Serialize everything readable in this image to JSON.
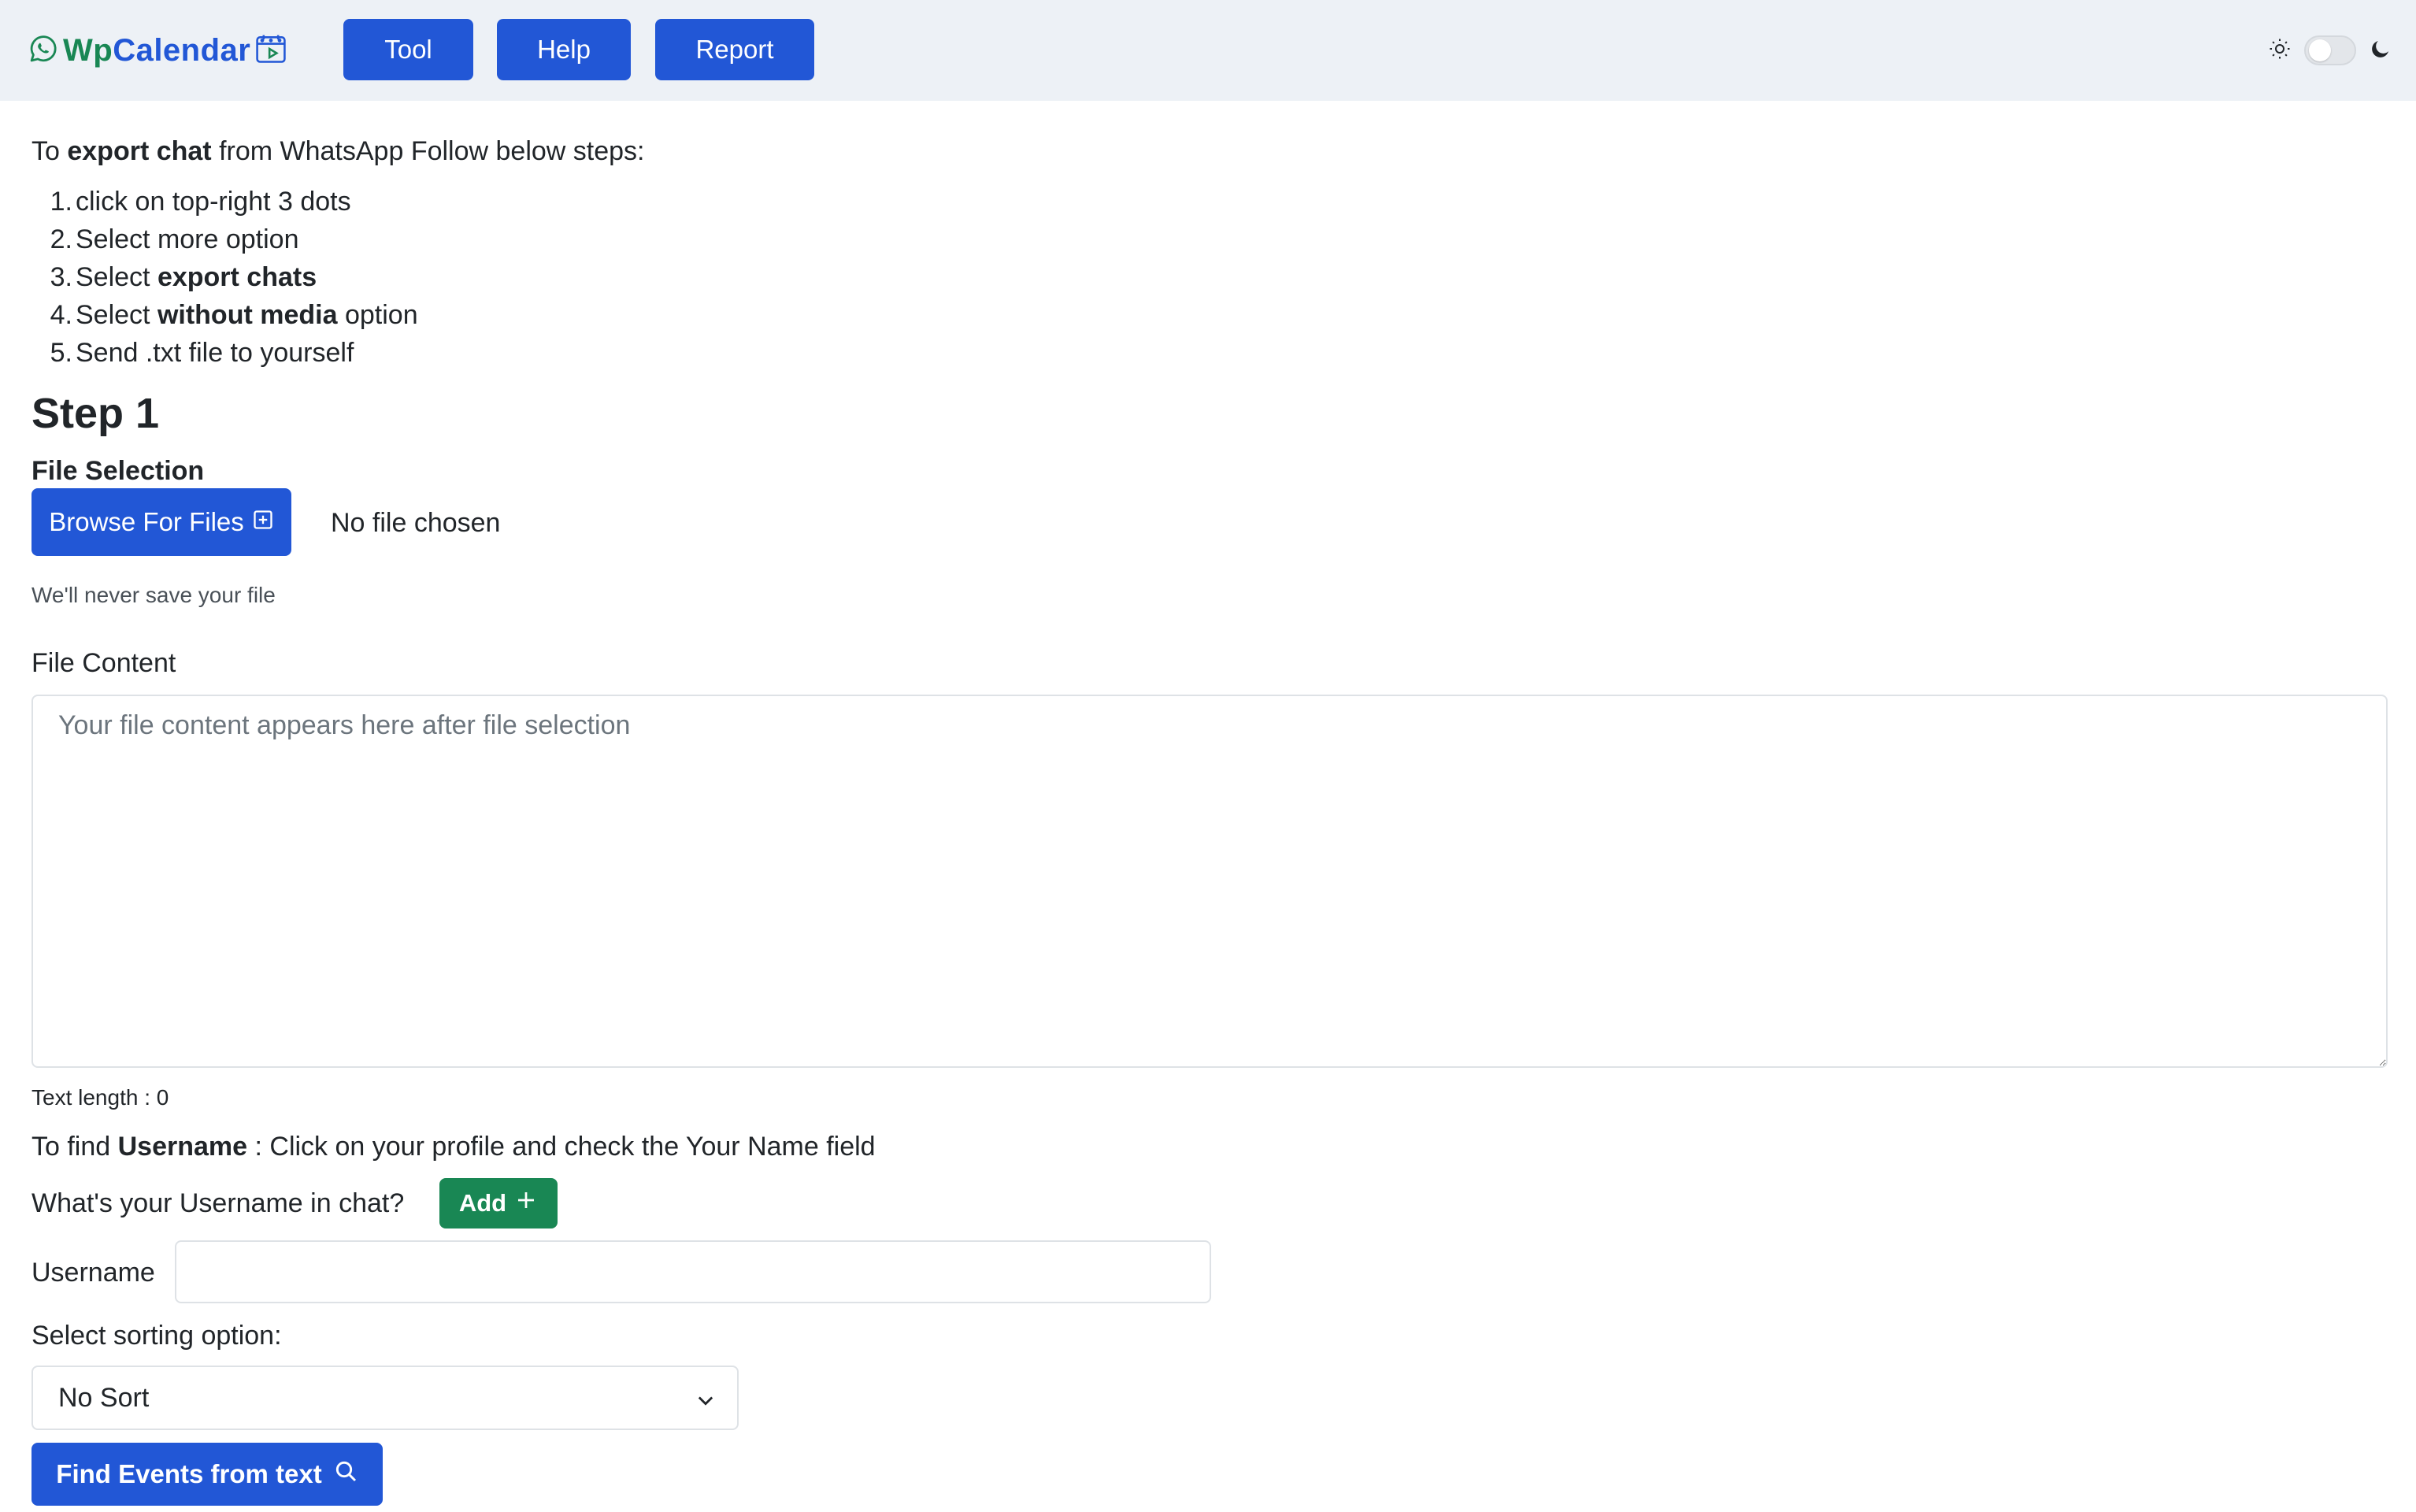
{
  "header": {
    "brand_part1": "Wp",
    "brand_part2": "Calendar",
    "nav": {
      "tool": "Tool",
      "help": "Help",
      "report": "Report"
    },
    "theme_toggle_on": false
  },
  "intro": {
    "prefix": "To ",
    "bold": "export chat",
    "suffix": " from WhatsApp Follow below steps:"
  },
  "steps": [
    {
      "num": "1.",
      "text": "click on top-right 3 dots",
      "bold": "",
      "after": ""
    },
    {
      "num": "2.",
      "text": "Select more option",
      "bold": "",
      "after": ""
    },
    {
      "num": "3.",
      "text": "Select ",
      "bold": "export chats",
      "after": ""
    },
    {
      "num": "4.",
      "text": "Select ",
      "bold": "without media",
      "after": " option"
    },
    {
      "num": "5.",
      "text": "Send .txt file to yourself",
      "bold": "",
      "after": ""
    }
  ],
  "step1": {
    "heading": "Step 1",
    "file_selection_label": "File Selection",
    "browse_label": "Browse For Files",
    "file_status": "No file chosen",
    "privacy_note": "We'll never save your file",
    "file_content_label": "File Content",
    "textarea_placeholder": "Your file content appears here after file selection",
    "text_length": "Text length : 0"
  },
  "username": {
    "hint_prefix": "To find ",
    "hint_bold": "Username",
    "hint_suffix": " : Click on your profile and check the Your Name field",
    "question": "What's your Username in chat?",
    "add_label": "Add",
    "field_label": "Username",
    "field_value": ""
  },
  "sorting": {
    "label": "Select sorting option:",
    "selected": "No Sort"
  },
  "find_button": "Find Events from text",
  "colors": {
    "primary": "#2257d6",
    "success": "#198754",
    "navbar_bg": "#edf1f6"
  }
}
